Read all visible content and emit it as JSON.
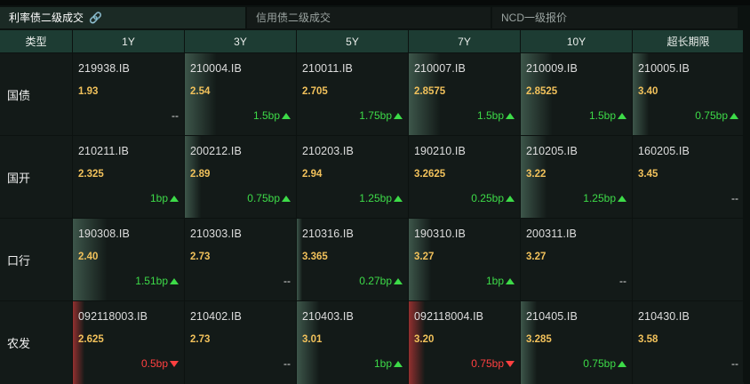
{
  "tabs": [
    {
      "label": "利率债二级成交",
      "active": true,
      "icon": "link-icon"
    },
    {
      "label": "信用债二级成交",
      "active": false
    },
    {
      "label": "NCD一级报价",
      "active": false
    }
  ],
  "columns": [
    "类型",
    "1Y",
    "3Y",
    "5Y",
    "7Y",
    "10Y",
    "超长期限"
  ],
  "colors": {
    "up": "#3ddb48",
    "down": "#ff4040",
    "yield": "#f1c15b",
    "header_bg": "#1d3c33"
  },
  "rows": [
    {
      "label": "国债",
      "cells": [
        {
          "code": "219938.IB",
          "yield": "1.93",
          "change": "--",
          "dir": "flat",
          "bar": 0.0
        },
        {
          "code": "210004.IB",
          "yield": "2.54",
          "change": "1.5bp",
          "dir": "up",
          "bar": 0.28
        },
        {
          "code": "210011.IB",
          "yield": "2.705",
          "change": "1.75bp",
          "dir": "up",
          "bar": 0.0
        },
        {
          "code": "210007.IB",
          "yield": "2.8575",
          "change": "1.5bp",
          "dir": "up",
          "bar": 0.28
        },
        {
          "code": "210009.IB",
          "yield": "2.8525",
          "change": "1.5bp",
          "dir": "up",
          "bar": 0.28
        },
        {
          "code": "210005.IB",
          "yield": "3.40",
          "change": "0.75bp",
          "dir": "up",
          "bar": 0.14
        }
      ]
    },
    {
      "label": "国开",
      "cells": [
        {
          "code": "210211.IB",
          "yield": "2.325",
          "change": "1bp",
          "dir": "up",
          "bar": 0.0
        },
        {
          "code": "200212.IB",
          "yield": "2.89",
          "change": "0.75bp",
          "dir": "up",
          "bar": 0.14
        },
        {
          "code": "210203.IB",
          "yield": "2.94",
          "change": "1.25bp",
          "dir": "up",
          "bar": 0.0
        },
        {
          "code": "190210.IB",
          "yield": "3.2625",
          "change": "0.25bp",
          "dir": "up",
          "bar": 0.0
        },
        {
          "code": "210205.IB",
          "yield": "3.22",
          "change": "1.25bp",
          "dir": "up",
          "bar": 0.23
        },
        {
          "code": "160205.IB",
          "yield": "3.45",
          "change": "--",
          "dir": "flat",
          "bar": 0.0
        }
      ]
    },
    {
      "label": "口行",
      "cells": [
        {
          "code": "190308.IB",
          "yield": "2.40",
          "change": "1.51bp",
          "dir": "up",
          "bar": 0.3
        },
        {
          "code": "210303.IB",
          "yield": "2.73",
          "change": "--",
          "dir": "flat",
          "bar": 0.0
        },
        {
          "code": "210316.IB",
          "yield": "3.365",
          "change": "0.27bp",
          "dir": "up",
          "bar": 0.05
        },
        {
          "code": "190310.IB",
          "yield": "3.27",
          "change": "1bp",
          "dir": "up",
          "bar": 0.2
        },
        {
          "code": "200311.IB",
          "yield": "3.27",
          "change": "--",
          "dir": "flat",
          "bar": 0.0
        },
        {
          "code": "",
          "yield": "",
          "change": "",
          "dir": "none",
          "bar": 0.0
        }
      ]
    },
    {
      "label": "农发",
      "cells": [
        {
          "code": "092118003.IB",
          "yield": "2.625",
          "change": "0.5bp",
          "dir": "down",
          "bar": 0.1
        },
        {
          "code": "210402.IB",
          "yield": "2.73",
          "change": "--",
          "dir": "flat",
          "bar": 0.0
        },
        {
          "code": "210403.IB",
          "yield": "3.01",
          "change": "1bp",
          "dir": "up",
          "bar": 0.2
        },
        {
          "code": "092118004.IB",
          "yield": "3.20",
          "change": "0.75bp",
          "dir": "down",
          "bar": 0.14
        },
        {
          "code": "210405.IB",
          "yield": "3.285",
          "change": "0.75bp",
          "dir": "up",
          "bar": 0.14
        },
        {
          "code": "210430.IB",
          "yield": "3.58",
          "change": "--",
          "dir": "flat",
          "bar": 0.0
        }
      ]
    }
  ]
}
